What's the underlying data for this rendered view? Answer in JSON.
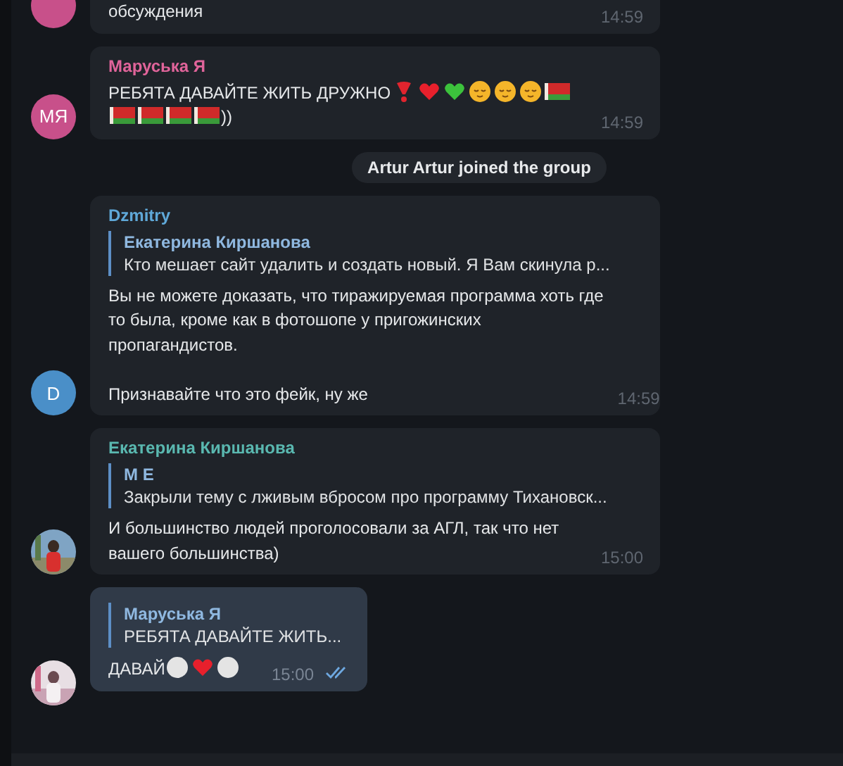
{
  "messages": [
    {
      "kind": "text",
      "own": false,
      "avatar": {
        "kind": "initials",
        "color": "#c8508a"
      },
      "text": "обсуждения",
      "time": "14:59"
    },
    {
      "kind": "text",
      "own": false,
      "avatar": {
        "kind": "initials",
        "text": "МЯ",
        "color": "#c8508a"
      },
      "sender": "Маруська Я",
      "color": "#e0649a",
      "text": "РЕБЯТА ДАВАЙТЕ ЖИТЬ ДРУЖНО",
      "emojis": [
        {
          "kind": "heart-exclamation"
        },
        {
          "kind": "red-heart"
        },
        {
          "kind": "green-heart"
        },
        {
          "kind": "relieved"
        },
        {
          "kind": "relieved"
        },
        {
          "kind": "relieved"
        },
        {
          "kind": "flag"
        },
        {
          "kind": "flag"
        },
        {
          "kind": "flag"
        },
        {
          "kind": "flag"
        },
        {
          "kind": "flag"
        }
      ],
      "tail": "))",
      "time": "14:59"
    },
    {
      "kind": "service",
      "text": "Artur Artur joined the group"
    },
    {
      "kind": "text",
      "own": false,
      "avatar": {
        "kind": "initials",
        "text": "D",
        "color": "#4a8fc8"
      },
      "sender": "Dzmitry",
      "color": "#5fa8d8",
      "reply": {
        "name": "Екатерина Киршанова",
        "text": "Кто мешает сайт удалить и создать новый. Я Вам скинула р..."
      },
      "text": "Вы не можете доказать, что тиражируемая программа хоть где\nто была, кроме как в фотошопе у пригожинских\nпропагандистов.\n\nПризнавайте что это фейк, ну же",
      "time": "14:59"
    },
    {
      "kind": "text",
      "own": false,
      "sender": "Екатерина Киршанова",
      "color": "#5ab8b0",
      "reply": {
        "name": "М Е",
        "text": "Закрыли тему с лживым вбросом про программу Тихановск..."
      },
      "text": "И большинство людей проголосовали за АГЛ, так что нет\nвашего большинства)",
      "time": "15:00"
    },
    {
      "kind": "text",
      "own": true,
      "read": true,
      "reply": {
        "name": "Маруська Я",
        "text": "РЕБЯТА ДАВАЙТЕ ЖИТЬ..."
      },
      "text": "ДАВАЙ",
      "emojis": [
        {
          "kind": "white-circle"
        },
        {
          "kind": "red-heart"
        },
        {
          "kind": "white-circle"
        }
      ],
      "time": "15:00"
    }
  ]
}
